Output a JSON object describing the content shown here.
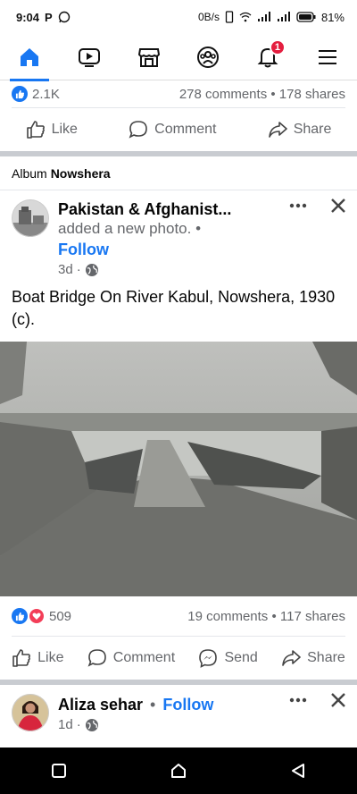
{
  "status": {
    "time": "9:04",
    "net": "0B/s",
    "battery": "81%"
  },
  "nav": {
    "notif_badge": "1"
  },
  "prev_post": {
    "reactions": "2.1K",
    "comments_shares": "278 comments • 178 shares",
    "like": "Like",
    "comment": "Comment",
    "share": "Share"
  },
  "album": {
    "prefix": "Album",
    "name": "Nowshera"
  },
  "post": {
    "page_name": "Pakistan & Afghanist...",
    "activity": "added a new photo.",
    "dot": "•",
    "follow": "Follow",
    "time": "3d",
    "caption": "Boat Bridge On River Kabul, Nowshera, 1930 (c).",
    "reactions": "509",
    "comments_shares": "19 comments • 117 shares",
    "like": "Like",
    "comment": "Comment",
    "send": "Send",
    "share": "Share"
  },
  "next_post": {
    "name": "Aliza sehar",
    "dot": "•",
    "follow": "Follow",
    "time": "1d"
  },
  "colors": {
    "accent": "#1877f2",
    "badge": "#e41e3f"
  }
}
